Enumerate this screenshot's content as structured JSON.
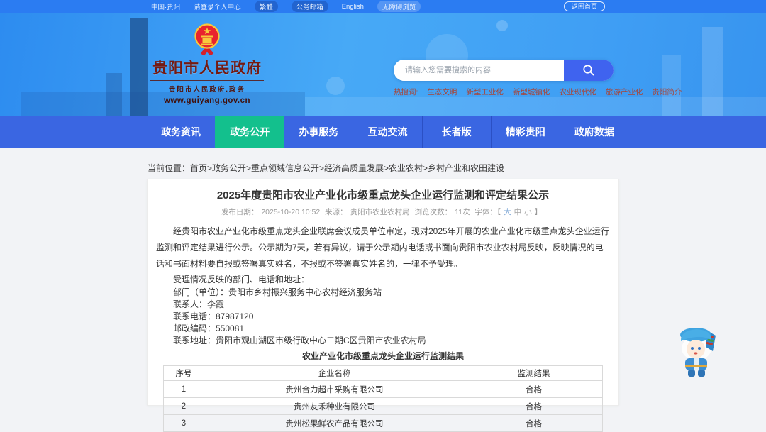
{
  "colors": {
    "topbar_blue": "#2b7cf2",
    "banner_blue": "#3e9ff4",
    "nav_blue": "#3a66e2",
    "active_green": "#13c08d",
    "site_title_red": "#751a12",
    "hotword_red": "#a5473c",
    "search_button_blue": "#3f63ef",
    "page_bg": "#f2f3f6"
  },
  "topbar": {
    "region": "中国·贵阳",
    "login": "请登录个人中心",
    "traditional": "繁體",
    "mail": "公务邮箱",
    "english": "English",
    "accessibility": "无障碍浏览",
    "back_home": "返回首页"
  },
  "header": {
    "site_title": "贵阳市人民政府",
    "site_subtitle": "贵阳市人民政府.政务",
    "site_url": "www.guiyang.gov.cn",
    "search_placeholder": "请输入您需要搜索的内容",
    "hot_label": "热搜词:",
    "hot_words": [
      "生态文明",
      "新型工业化",
      "新型城镇化",
      "农业现代化",
      "旅游产业化",
      "贵阳简介"
    ]
  },
  "nav": {
    "items": [
      "政务资讯",
      "政务公开",
      "办事服务",
      "互动交流",
      "长者版",
      "精彩贵阳",
      "政府数据"
    ],
    "active_index": 1
  },
  "breadcrumb": {
    "label": "当前位置：",
    "path": "首页>政务公开>重点领域信息公开>经济高质量发展>农业农村>乡村产业和农田建设"
  },
  "article": {
    "title": "2025年度贵阳市农业产业化市级重点龙头企业运行监测和评定结果公示",
    "meta": {
      "date_label": "发布日期：",
      "date": "2025-10-20 10:52",
      "source_label": "来源：",
      "source": "贵阳市农业农村局",
      "views_label": "浏览次数：",
      "views": "11次",
      "font_label": "字体：【",
      "font_large": "大",
      "font_medium": "中",
      "font_small": "小",
      "font_bracket_close": "】"
    },
    "paragraph": "经贵阳市农业产业化市级重点龙头企业联席会议成员单位审定，现对2025年开展的农业产业化市级重点龙头企业运行监测和评定结果进行公示。公示期为7天，若有异议，请于公示期内电话或书面向贵阳市农业农村局反映，反映情况的电话和书面材料要自报或签署真实姓名，不报或不签署真实姓名的，一律不予受理。",
    "contact_intro": "受理情况反映的部门、电话和地址：",
    "contact_lines": [
      "部门（单位）：贵阳市乡村振兴服务中心农村经济服务站",
      "联系人：李霞",
      "联系电话：87987120",
      "邮政编码：550081",
      "联系地址：贵阳市观山湖区市级行政中心二期C区贵阳市农业农村局"
    ],
    "table": {
      "caption": "农业产业化市级重点龙头企业运行监测结果",
      "headers": [
        "序号",
        "企业名称",
        "监测结果"
      ],
      "rows": [
        [
          "1",
          "贵州合力超市采购有限公司",
          "合格"
        ],
        [
          "2",
          "贵州友禾种业有限公司",
          "合格"
        ],
        [
          "3",
          "贵州松果鲜农产品有限公司",
          "合格"
        ]
      ]
    }
  },
  "icons": {
    "search": "magnifier-icon",
    "emblem": "national-emblem-icon",
    "mascot": "assistant-mascot-icon"
  }
}
